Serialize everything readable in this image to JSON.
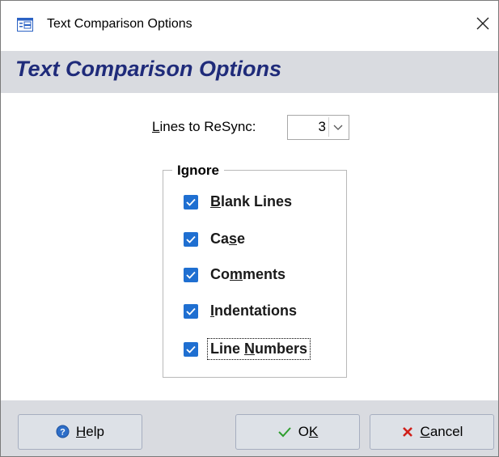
{
  "window": {
    "title": "Text Comparison Options"
  },
  "header": {
    "title": "Text Comparison Options"
  },
  "resync": {
    "label_prefix": "",
    "label_underlined": "L",
    "label_rest": "ines to ReSync:",
    "value": "3"
  },
  "ignore": {
    "legend": "Ignore",
    "options": [
      {
        "pre": "",
        "ul": "B",
        "post": "lank Lines",
        "checked": true
      },
      {
        "pre": "Ca",
        "ul": "s",
        "post": "e",
        "checked": true
      },
      {
        "pre": "Co",
        "ul": "m",
        "post": "ments",
        "checked": true
      },
      {
        "pre": "",
        "ul": "I",
        "post": "ndentations",
        "checked": true
      },
      {
        "pre": "Line ",
        "ul": "N",
        "post": "umbers",
        "checked": true
      }
    ]
  },
  "buttons": {
    "help": {
      "pre": "",
      "ul": "H",
      "post": "elp"
    },
    "ok": {
      "pre": "O",
      "ul": "K",
      "post": ""
    },
    "cancel": {
      "pre": "",
      "ul": "C",
      "post": "ancel"
    }
  },
  "colors": {
    "accent": "#1f6fd1",
    "header_text": "#1f2b7a",
    "header_bg": "#d9dbe0",
    "cancel_x": "#d0201a",
    "ok_check": "#2e9e2e"
  }
}
